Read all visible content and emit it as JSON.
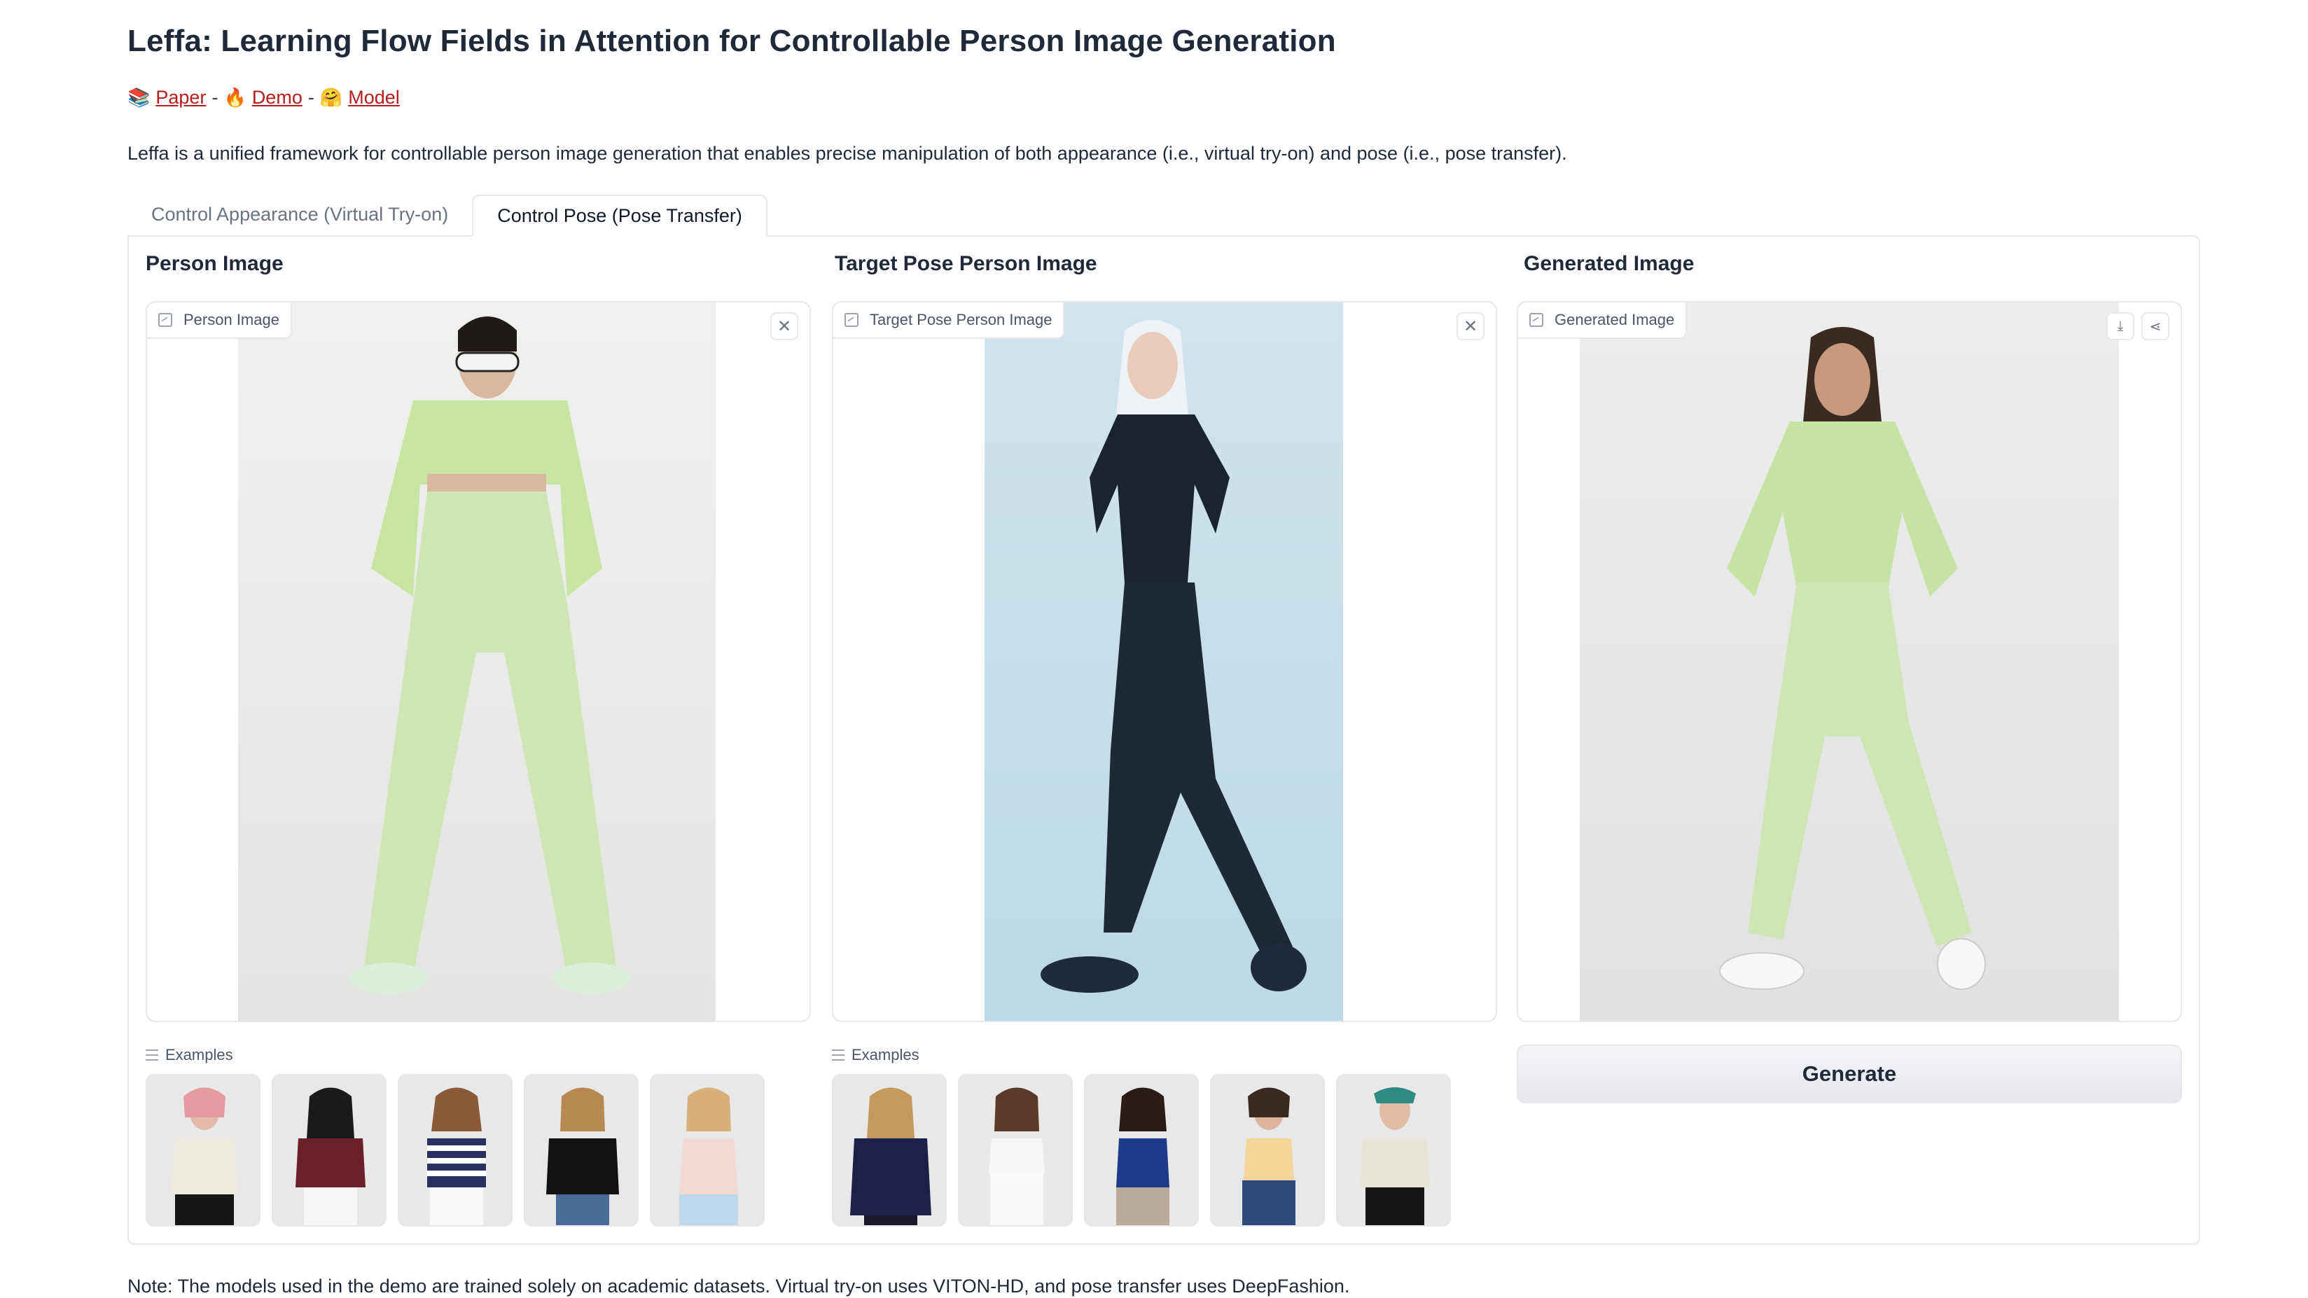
{
  "header": {
    "title": "Leffa: Learning Flow Fields in Attention for Controllable Person Image Generation",
    "links": [
      {
        "emoji": "📚",
        "label": "Paper"
      },
      {
        "emoji": "🔥",
        "label": "Demo"
      },
      {
        "emoji": "🤗",
        "label": "Model"
      }
    ],
    "separator": "-",
    "description": "Leffa is a unified framework for controllable person image generation that enables precise manipulation of both appearance (i.e., virtual try-on) and pose (i.e., pose transfer)."
  },
  "tabs": [
    {
      "label": "Control Appearance (Virtual Try-on)",
      "active": false
    },
    {
      "label": "Control Pose (Pose Transfer)",
      "active": true
    }
  ],
  "columns": {
    "person": {
      "title": "Person Image",
      "box_label": "Person Image"
    },
    "target": {
      "title": "Target Pose Person Image",
      "box_label": "Target Pose Person Image"
    },
    "generated": {
      "title": "Generated Image",
      "box_label": "Generated Image"
    }
  },
  "examples": {
    "label": "Examples"
  },
  "generate_label": "Generate",
  "note": "Note: The models used in the demo are trained solely on academic datasets. Virtual try-on uses VITON-HD, and pose transfer uses DeepFashion.",
  "icons": {
    "close": "close-icon",
    "download": "download-icon",
    "share": "share-icon",
    "image": "image-icon",
    "list": "list-icon"
  },
  "colors": {
    "link": "#b91c1c",
    "border": "#e5e7eb",
    "outfit_green": "#c5e3a3"
  }
}
